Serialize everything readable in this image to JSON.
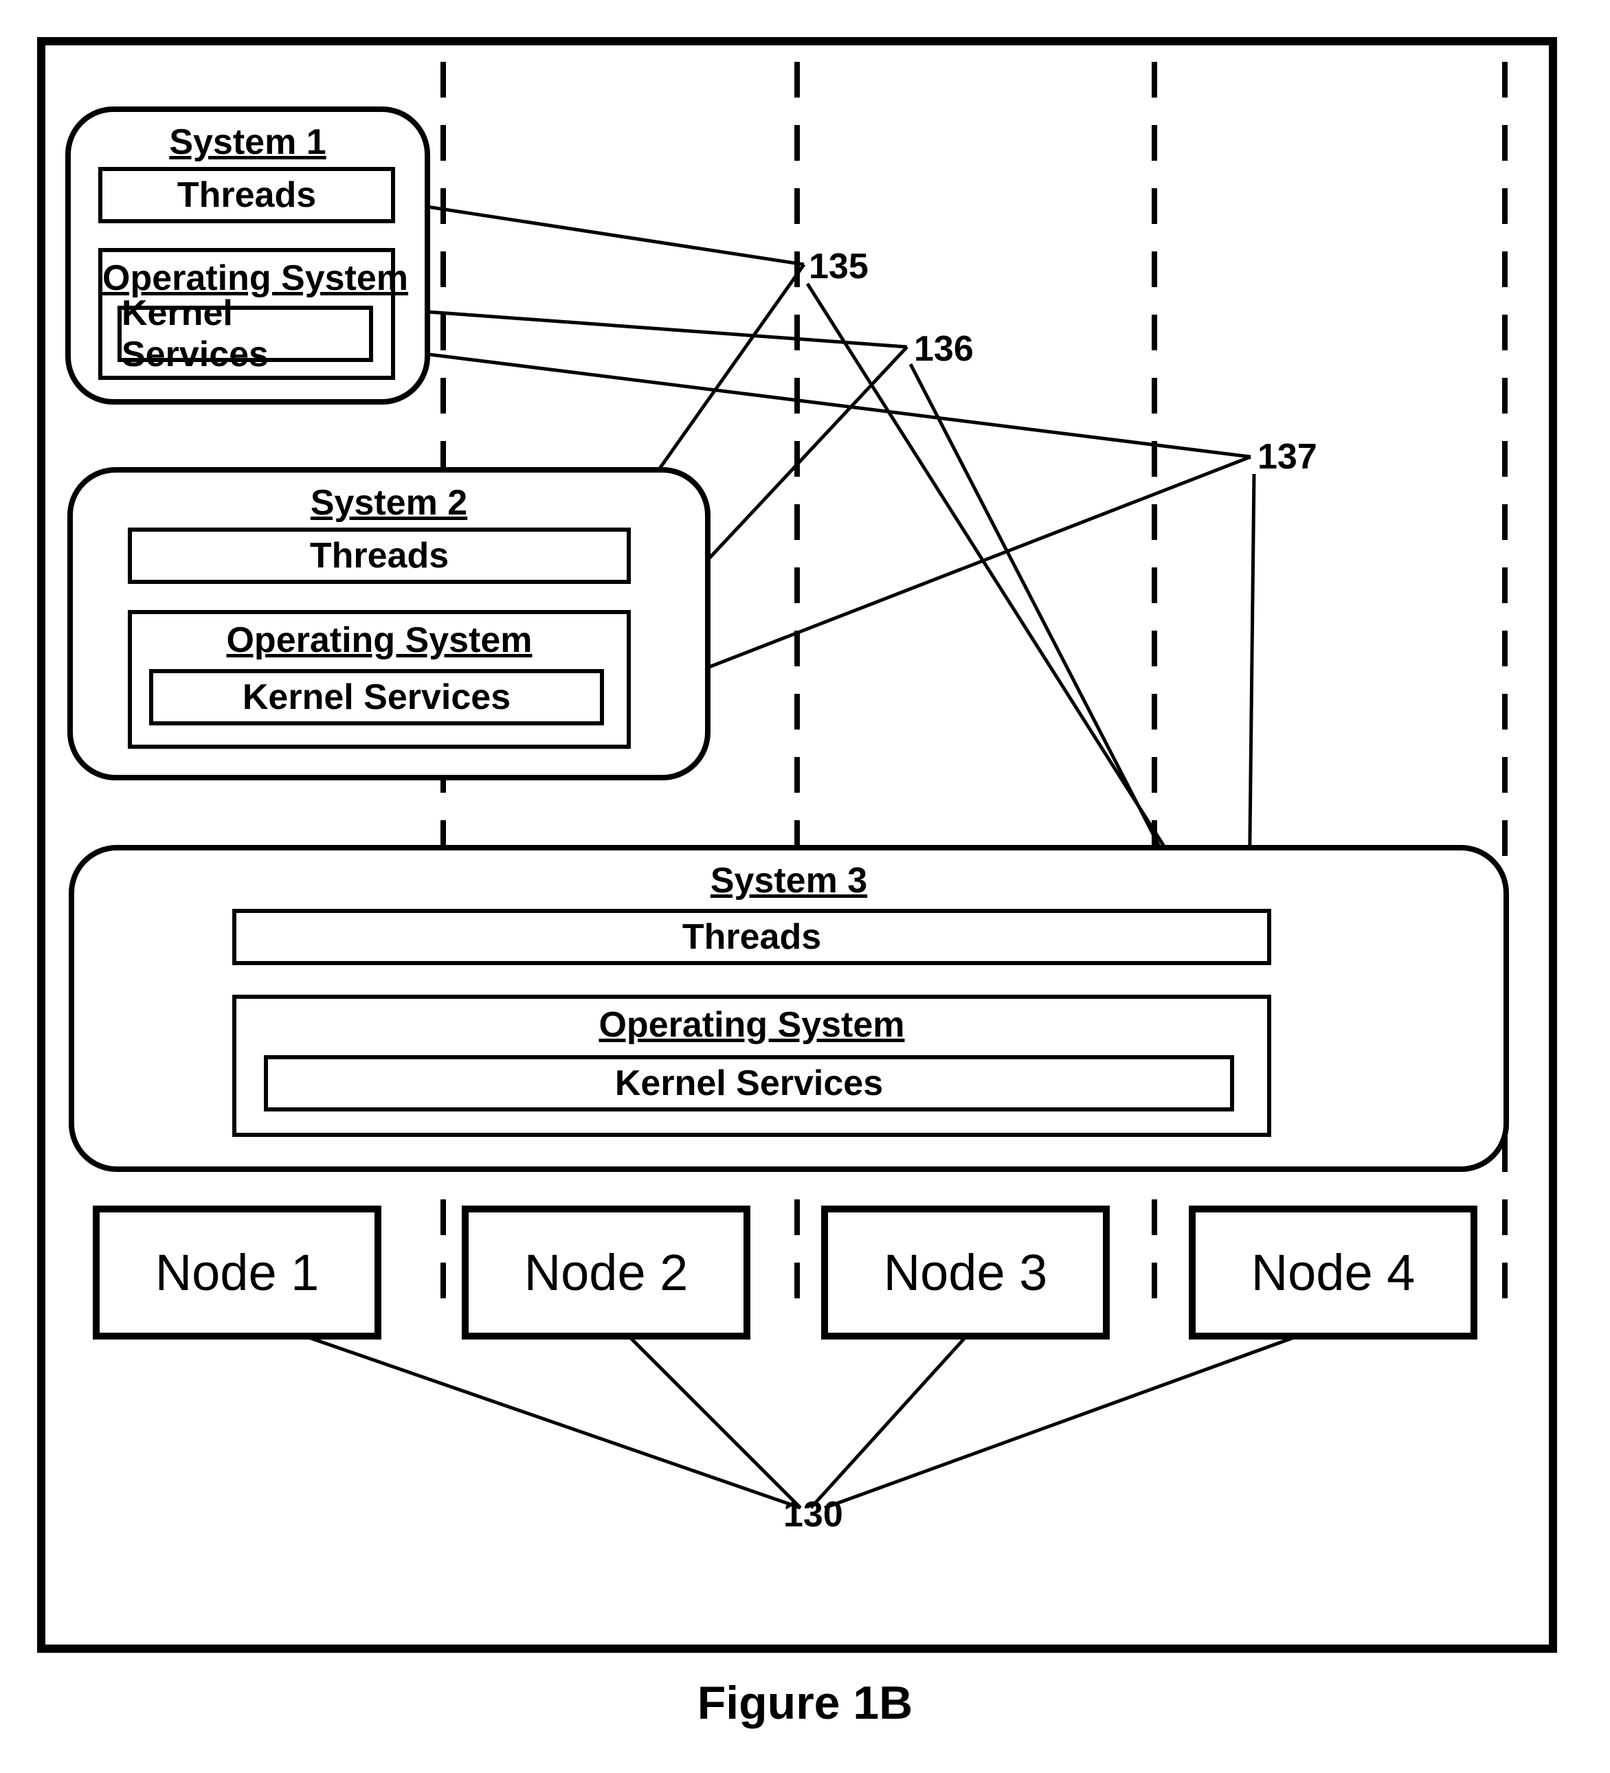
{
  "caption": "Figure 1B",
  "refs": {
    "r130": "130",
    "r135": "135",
    "r136": "136",
    "r137": "137"
  },
  "systems": {
    "s1": {
      "title": "System 1",
      "threads": "Threads",
      "os_title": "Operating System",
      "kernel": "Kernel Services"
    },
    "s2": {
      "title": "System 2",
      "threads": "Threads",
      "os_title": "Operating System",
      "kernel": "Kernel Services"
    },
    "s3": {
      "title": "System 3",
      "threads": "Threads",
      "os_title": "Operating System",
      "kernel": "Kernel Services"
    }
  },
  "nodes": {
    "n1": "Node 1",
    "n2": "Node 2",
    "n3": "Node 3",
    "n4": "Node 4"
  }
}
